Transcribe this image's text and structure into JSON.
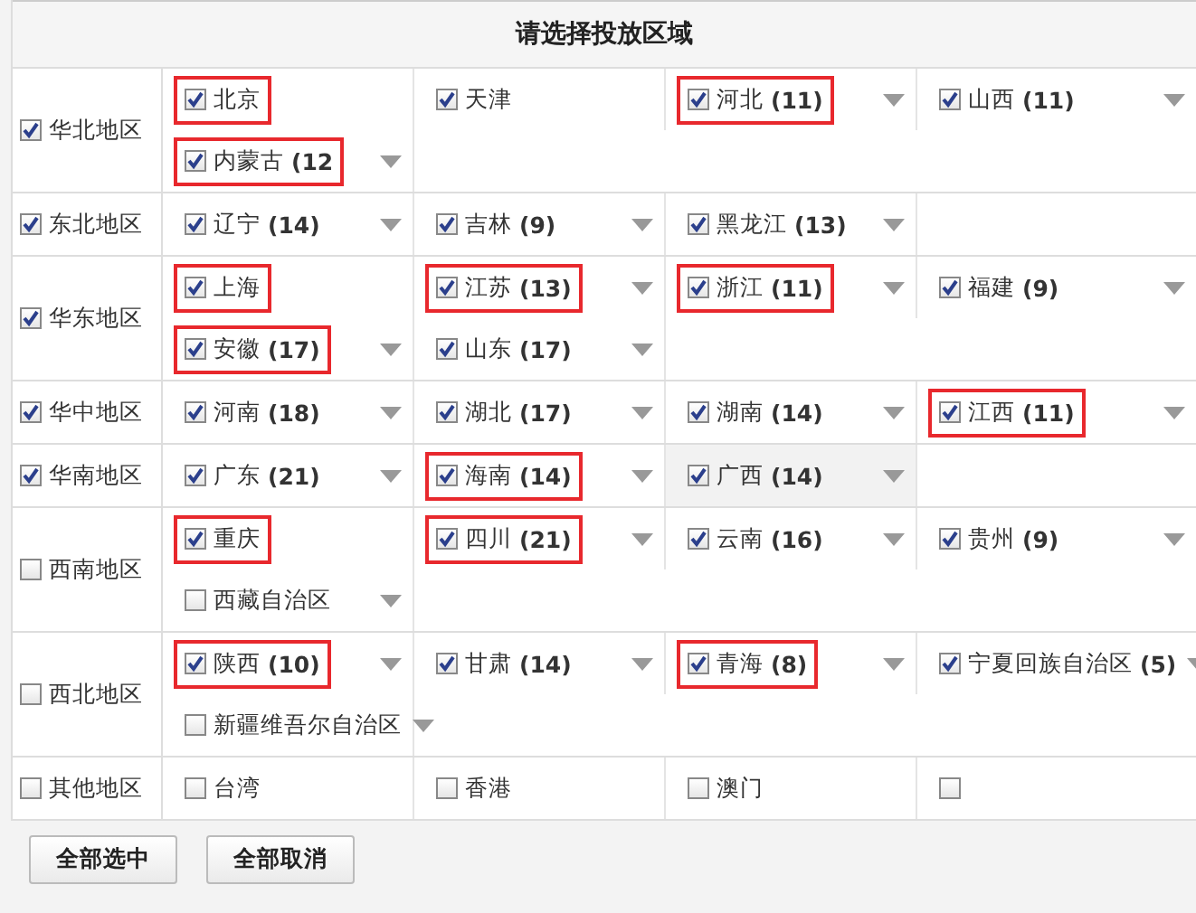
{
  "title": "请选择投放区域",
  "groups": [
    {
      "name": "华北地区",
      "checked": true,
      "items": [
        {
          "name": "北京",
          "checked": true,
          "dropdown": false,
          "highlighted": true
        },
        {
          "name": "天津",
          "checked": true,
          "dropdown": false,
          "highlighted": false
        },
        {
          "name": "河北",
          "count": "(11)",
          "checked": true,
          "dropdown": true,
          "highlighted": true
        },
        {
          "name": "山西",
          "count": "(11)",
          "checked": true,
          "dropdown": true,
          "highlighted": false
        },
        {
          "name": "内蒙古",
          "count": "(12",
          "checked": true,
          "dropdown": true,
          "highlighted": true
        }
      ]
    },
    {
      "name": "东北地区",
      "checked": true,
      "items": [
        {
          "name": "辽宁",
          "count": "(14)",
          "checked": true,
          "dropdown": true,
          "highlighted": false
        },
        {
          "name": "吉林",
          "count": "(9)",
          "checked": true,
          "dropdown": true,
          "highlighted": false
        },
        {
          "name": "黑龙江",
          "count": "(13)",
          "checked": true,
          "dropdown": true,
          "highlighted": false
        }
      ]
    },
    {
      "name": "华东地区",
      "checked": true,
      "items": [
        {
          "name": "上海",
          "checked": true,
          "dropdown": false,
          "highlighted": true
        },
        {
          "name": "江苏",
          "count": "(13)",
          "checked": true,
          "dropdown": true,
          "highlighted": true
        },
        {
          "name": "浙江",
          "count": "(11)",
          "checked": true,
          "dropdown": true,
          "highlighted": true
        },
        {
          "name": "福建",
          "count": "(9)",
          "checked": true,
          "dropdown": true,
          "highlighted": false
        },
        {
          "name": "安徽",
          "count": "(17)",
          "checked": true,
          "dropdown": true,
          "highlighted": true
        },
        {
          "name": "山东",
          "count": "(17)",
          "checked": true,
          "dropdown": true,
          "highlighted": false
        }
      ]
    },
    {
      "name": "华中地区",
      "checked": true,
      "items": [
        {
          "name": "河南",
          "count": "(18)",
          "checked": true,
          "dropdown": true,
          "highlighted": false
        },
        {
          "name": "湖北",
          "count": "(17)",
          "checked": true,
          "dropdown": true,
          "highlighted": false
        },
        {
          "name": "湖南",
          "count": "(14)",
          "checked": true,
          "dropdown": true,
          "highlighted": false
        },
        {
          "name": "江西",
          "count": "(11)",
          "checked": true,
          "dropdown": true,
          "highlighted": true
        }
      ]
    },
    {
      "name": "华南地区",
      "checked": true,
      "items": [
        {
          "name": "广东",
          "count": "(21)",
          "checked": true,
          "dropdown": true,
          "highlighted": false
        },
        {
          "name": "海南",
          "count": "(14)",
          "checked": true,
          "dropdown": true,
          "highlighted": true
        },
        {
          "name": "广西",
          "count": "(14)",
          "checked": true,
          "dropdown": true,
          "highlighted": false,
          "shaded": true
        }
      ]
    },
    {
      "name": "西南地区",
      "checked": false,
      "items": [
        {
          "name": "重庆",
          "checked": true,
          "dropdown": false,
          "highlighted": true
        },
        {
          "name": "四川",
          "count": "(21)",
          "checked": true,
          "dropdown": true,
          "highlighted": true
        },
        {
          "name": "云南",
          "count": "(16)",
          "checked": true,
          "dropdown": true,
          "highlighted": false
        },
        {
          "name": "贵州",
          "count": "(9)",
          "checked": true,
          "dropdown": true,
          "highlighted": false
        },
        {
          "name": "西藏自治区",
          "checked": false,
          "dropdown": true,
          "highlighted": false
        }
      ]
    },
    {
      "name": "西北地区",
      "checked": false,
      "items": [
        {
          "name": "陕西",
          "count": "(10)",
          "checked": true,
          "dropdown": true,
          "highlighted": true
        },
        {
          "name": "甘肃",
          "count": "(14)",
          "checked": true,
          "dropdown": true,
          "highlighted": false
        },
        {
          "name": "青海",
          "count": "(8)",
          "checked": true,
          "dropdown": true,
          "highlighted": true
        },
        {
          "name": "宁夏回族自治区",
          "count": "(5)",
          "checked": true,
          "dropdown": true,
          "highlighted": false
        },
        {
          "name": "新疆维吾尔自治区",
          "checked": false,
          "dropdown": true,
          "highlighted": false
        }
      ]
    },
    {
      "name": "其他地区",
      "checked": false,
      "items": [
        {
          "name": "台湾",
          "checked": false,
          "dropdown": false,
          "highlighted": false
        },
        {
          "name": "香港",
          "checked": false,
          "dropdown": false,
          "highlighted": false
        },
        {
          "name": "澳门",
          "checked": false,
          "dropdown": false,
          "highlighted": false
        },
        {
          "checked": false,
          "dropdown": false,
          "highlighted": false
        }
      ]
    }
  ],
  "buttons": [
    "全部选中",
    "全部取消"
  ]
}
